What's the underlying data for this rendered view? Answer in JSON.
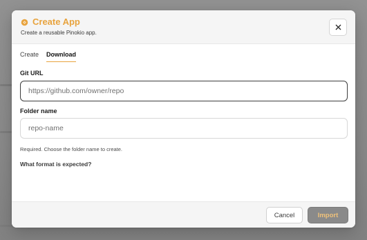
{
  "dialog": {
    "title": "Create App",
    "subtitle": "Create a reusable Pinokio app.",
    "title_icon": "pinokio-logo-icon",
    "close_icon": "close-icon"
  },
  "tabs": [
    {
      "label": "Create",
      "active": false
    },
    {
      "label": "Download",
      "active": true
    }
  ],
  "form": {
    "git_url": {
      "label": "Git URL",
      "placeholder": "https://github.com/owner/repo",
      "value": ""
    },
    "folder_name": {
      "label": "Folder name",
      "placeholder": "repo-name",
      "value": ""
    },
    "hint": "Required. Choose the folder name to create.",
    "faq_link": "What format is expected?"
  },
  "footer": {
    "cancel_label": "Cancel",
    "import_label": "Import",
    "import_disabled": true
  },
  "colors": {
    "accent": "#e8a33d",
    "import_bg": "#8a8a8a",
    "import_text": "#f0c27a"
  }
}
